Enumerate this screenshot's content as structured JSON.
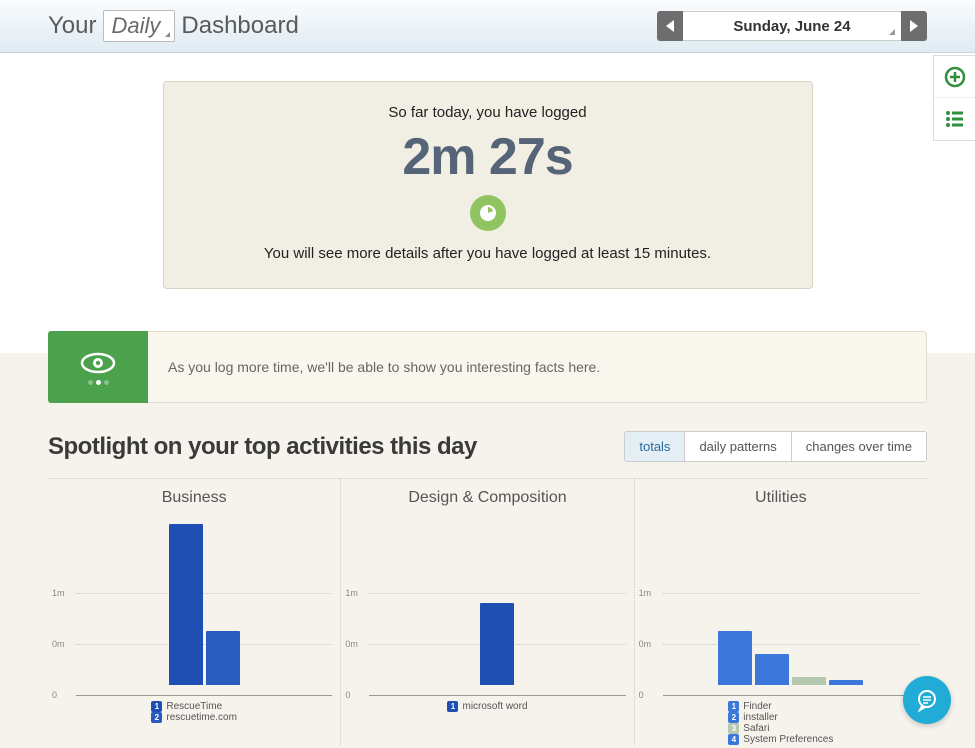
{
  "header": {
    "title_prefix": "Your",
    "period": "Daily",
    "title_suffix": "Dashboard",
    "date_display": "Sunday, June 24"
  },
  "summary": {
    "pre_text": "So far today, you have logged",
    "logged_time": "2m 27s",
    "post_text": "You will see more details after you have logged at least 15 minutes."
  },
  "info_strip": {
    "message": "As you log more time, we'll be able to show you interesting facts here."
  },
  "spotlight": {
    "title": "Spotlight on your top activities this day",
    "tabs": {
      "totals": "totals",
      "daily": "daily patterns",
      "changes": "changes over time"
    }
  },
  "chart_data": [
    {
      "type": "bar",
      "title": "Business",
      "ylabels": [
        "1m",
        "0m",
        "0"
      ],
      "ylim_seconds": [
        0,
        100
      ],
      "series": [
        {
          "name": "RescueTime",
          "value_seconds": 95,
          "color": "#1f4fb3"
        },
        {
          "name": "rescuetime.com",
          "value_seconds": 32,
          "color": "#2a5cbf"
        }
      ]
    },
    {
      "type": "bar",
      "title": "Design & Composition",
      "ylabels": [
        "1m",
        "0m",
        "0"
      ],
      "ylim_seconds": [
        0,
        100
      ],
      "series": [
        {
          "name": "microsoft word",
          "value_seconds": 48,
          "color": "#1f4fb3"
        }
      ]
    },
    {
      "type": "bar",
      "title": "Utilities",
      "ylabels": [
        "1m",
        "0m",
        "0"
      ],
      "ylim_seconds": [
        0,
        100
      ],
      "series": [
        {
          "name": "Finder",
          "value_seconds": 32,
          "color": "#3c77db"
        },
        {
          "name": "installer",
          "value_seconds": 18,
          "color": "#3c77db"
        },
        {
          "name": "Safari",
          "value_seconds": 5,
          "color": "#b5c9b0"
        },
        {
          "name": "System Preferences",
          "value_seconds": 3,
          "color": "#3c77db"
        }
      ]
    }
  ]
}
